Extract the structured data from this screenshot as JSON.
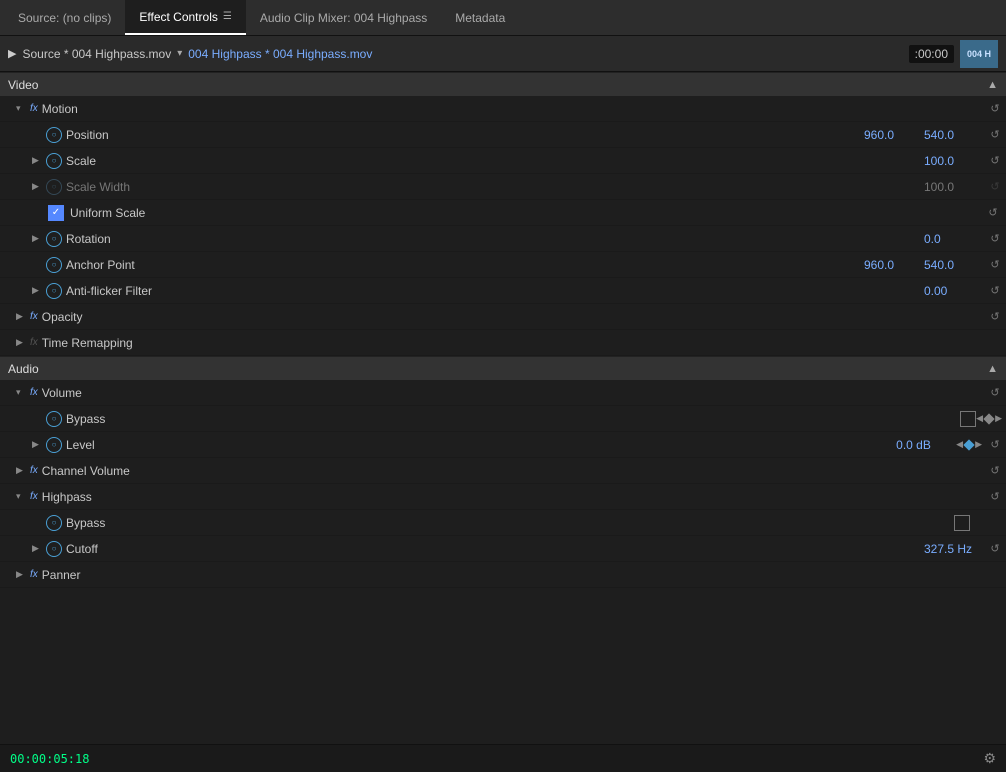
{
  "tabs": [
    {
      "id": "source",
      "label": "Source: (no clips)",
      "active": false
    },
    {
      "id": "effect-controls",
      "label": "Effect Controls",
      "active": true,
      "hasMenu": true
    },
    {
      "id": "audio-clip-mixer",
      "label": "Audio Clip Mixer: 004 Highpass",
      "active": false
    },
    {
      "id": "metadata",
      "label": "Metadata",
      "active": false
    }
  ],
  "source_bar": {
    "play_icon": "▶",
    "source_label": "Source * 004 Highpass.mov",
    "dropdown_icon": "▾",
    "clip_label": "004 Highpass * 004 Highpass.mov",
    "timecode": ":00:00",
    "thumbnail_label": "004 H"
  },
  "sections": {
    "video": {
      "label": "Video",
      "collapse": "▲"
    },
    "audio": {
      "label": "Audio",
      "collapse": "▲"
    }
  },
  "video_effects": {
    "motion": {
      "label": "Motion",
      "properties": {
        "position": {
          "label": "Position",
          "x": "960.0",
          "y": "540.0"
        },
        "scale": {
          "label": "Scale",
          "value": "100.0"
        },
        "scale_width": {
          "label": "Scale Width",
          "value": "100.0",
          "muted": true
        },
        "uniform_scale": {
          "label": "Uniform Scale",
          "checked": true
        },
        "rotation": {
          "label": "Rotation",
          "value": "0.0"
        },
        "anchor_point": {
          "label": "Anchor Point",
          "x": "960.0",
          "y": "540.0"
        },
        "anti_flicker": {
          "label": "Anti-flicker Filter",
          "value": "0.00"
        }
      }
    },
    "opacity": {
      "label": "Opacity"
    },
    "time_remapping": {
      "label": "Time Remapping"
    }
  },
  "audio_effects": {
    "volume": {
      "label": "Volume",
      "bypass": {
        "label": "Bypass"
      },
      "level": {
        "label": "Level",
        "value": "0.0 dB"
      }
    },
    "channel_volume": {
      "label": "Channel Volume"
    },
    "highpass": {
      "label": "Highpass",
      "bypass": {
        "label": "Bypass"
      },
      "cutoff": {
        "label": "Cutoff",
        "value": "327.5 Hz"
      }
    },
    "panner": {
      "label": "Panner"
    }
  },
  "status": {
    "timecode": "00:00:05:18"
  },
  "icons": {
    "reset": "↺",
    "expand": "▶",
    "collapse_section": "▾",
    "gear": "⚙",
    "nav_left": "◀",
    "nav_right": "▶"
  }
}
